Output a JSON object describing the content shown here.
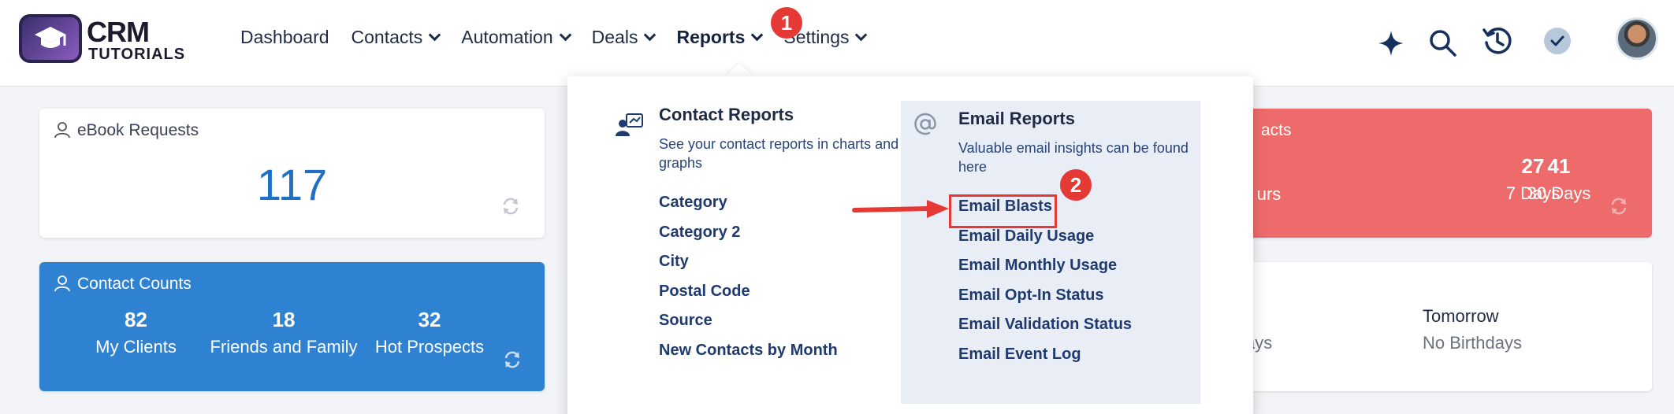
{
  "brand": {
    "line1": "CRM",
    "line2": "TUTORIALS"
  },
  "nav": {
    "items": [
      {
        "label": "Dashboard",
        "dropdown": false
      },
      {
        "label": "Contacts",
        "dropdown": true
      },
      {
        "label": "Automation",
        "dropdown": true
      },
      {
        "label": "Deals",
        "dropdown": true
      },
      {
        "label": "Reports",
        "dropdown": true,
        "active": true
      },
      {
        "label": "Settings",
        "dropdown": true
      }
    ]
  },
  "annotations": {
    "step1": "1",
    "step2": "2"
  },
  "header_icons": [
    "sparkle-icon",
    "search-icon",
    "history-icon",
    "check-circle-icon",
    "avatar"
  ],
  "cards": {
    "ebook": {
      "title": "eBook Requests",
      "value": "117"
    },
    "contact_counts": {
      "title": "Contact Counts",
      "stats": [
        {
          "value": "82",
          "label": "My Clients"
        },
        {
          "value": "18",
          "label": "Friends and Family"
        },
        {
          "value": "32",
          "label": "Hot Prospects"
        }
      ]
    },
    "new_contacts": {
      "title_partial": "acts",
      "stats": [
        {
          "value": "",
          "label": "urs"
        },
        {
          "value": "27",
          "label": "7 Days"
        },
        {
          "value": "41",
          "label": "30 Days"
        }
      ]
    },
    "birthdays": {
      "partial_label": "ays",
      "tomorrow_title": "Tomorrow",
      "tomorrow_value": "No Birthdays"
    }
  },
  "reports_menu": {
    "contact_reports": {
      "heading": "Contact Reports",
      "description": "See your contact reports in charts and graphs",
      "links": [
        "Category",
        "Category 2",
        "City",
        "Postal Code",
        "Source",
        "New Contacts by Month"
      ]
    },
    "email_reports": {
      "heading": "Email Reports",
      "description": "Valuable email insights can be found here",
      "links": [
        "Email Blasts",
        "Email Daily Usage",
        "Email Monthly Usage",
        "Email Opt-In Status",
        "Email Validation Status",
        "Email Event Log"
      ]
    }
  },
  "colors": {
    "accent_red": "#e53935",
    "card_blue": "#2f82d2",
    "card_red": "#ee6b6b",
    "number_blue": "#1f6fc5"
  }
}
